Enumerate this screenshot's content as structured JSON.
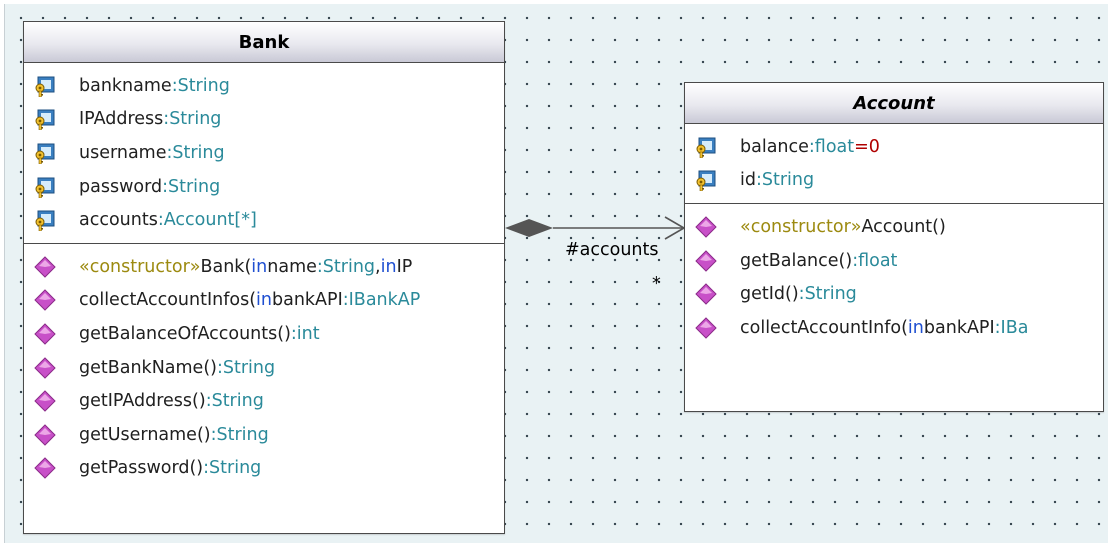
{
  "classes": {
    "bank": {
      "name": "Bank",
      "attributes": [
        {
          "name": "bankname",
          "type": ":String"
        },
        {
          "name": "IPAddress",
          "type": ":String"
        },
        {
          "name": "username",
          "type": ":String"
        },
        {
          "name": "password",
          "type": ":String"
        },
        {
          "name": "accounts",
          "type": ":Account[*]"
        }
      ],
      "operations": [
        {
          "parts": [
            {
              "t": "«constructor»",
              "s": "stereo"
            },
            {
              "t": " Bank(",
              "s": "name"
            },
            {
              "t": "in",
              "s": "kw"
            },
            {
              "t": " name",
              "s": "name"
            },
            {
              "t": ":String",
              "s": "type"
            },
            {
              "t": ", ",
              "s": "name"
            },
            {
              "t": "in",
              "s": "kw"
            },
            {
              "t": " IP",
              "s": "name"
            }
          ]
        },
        {
          "parts": [
            {
              "t": "collectAccountInfos(",
              "s": "name"
            },
            {
              "t": "in",
              "s": "kw"
            },
            {
              "t": " bankAPI",
              "s": "name"
            },
            {
              "t": ":IBankAP",
              "s": "type"
            }
          ]
        },
        {
          "parts": [
            {
              "t": "getBalanceOfAccounts()",
              "s": "name"
            },
            {
              "t": ":int",
              "s": "type"
            }
          ]
        },
        {
          "parts": [
            {
              "t": "getBankName()",
              "s": "name"
            },
            {
              "t": ":String",
              "s": "type"
            }
          ]
        },
        {
          "parts": [
            {
              "t": "getIPAddress()",
              "s": "name"
            },
            {
              "t": ":String",
              "s": "type"
            }
          ]
        },
        {
          "parts": [
            {
              "t": "getUsername()",
              "s": "name"
            },
            {
              "t": ":String",
              "s": "type"
            }
          ]
        },
        {
          "parts": [
            {
              "t": "getPassword()",
              "s": "name"
            },
            {
              "t": ":String",
              "s": "type"
            }
          ]
        }
      ]
    },
    "account": {
      "name": "Account",
      "attributes": [
        {
          "name": "balance",
          "type": ":float",
          "default": "=0"
        },
        {
          "name": "id",
          "type": ":String"
        }
      ],
      "operations": [
        {
          "parts": [
            {
              "t": "«constructor»",
              "s": "stereo"
            },
            {
              "t": " Account()",
              "s": "name"
            }
          ]
        },
        {
          "parts": [
            {
              "t": "getBalance()",
              "s": "name"
            },
            {
              "t": ":float",
              "s": "type"
            }
          ]
        },
        {
          "parts": [
            {
              "t": "getId()",
              "s": "name"
            },
            {
              "t": ":String",
              "s": "type"
            }
          ]
        },
        {
          "parts": [
            {
              "t": "collectAccountInfo(",
              "s": "name"
            },
            {
              "t": "in",
              "s": "kw"
            },
            {
              "t": " bankAPI",
              "s": "name"
            },
            {
              "t": ":IBa",
              "s": "type"
            }
          ]
        }
      ]
    }
  },
  "association": {
    "kind": "composition",
    "role": "#accounts",
    "multiplicity": "*"
  },
  "colors": {
    "canvas": "#e9f2f4",
    "type": "#2a8a9a",
    "keyword": "#1f4fd1",
    "stereotype": "#9c8a10",
    "default_value": "#b00000",
    "operation_icon": "#c850c8",
    "attribute_icon": "#3a7fc0"
  },
  "icons": {
    "attribute": "private-attribute-key-icon",
    "operation": "operation-diamond-icon"
  }
}
